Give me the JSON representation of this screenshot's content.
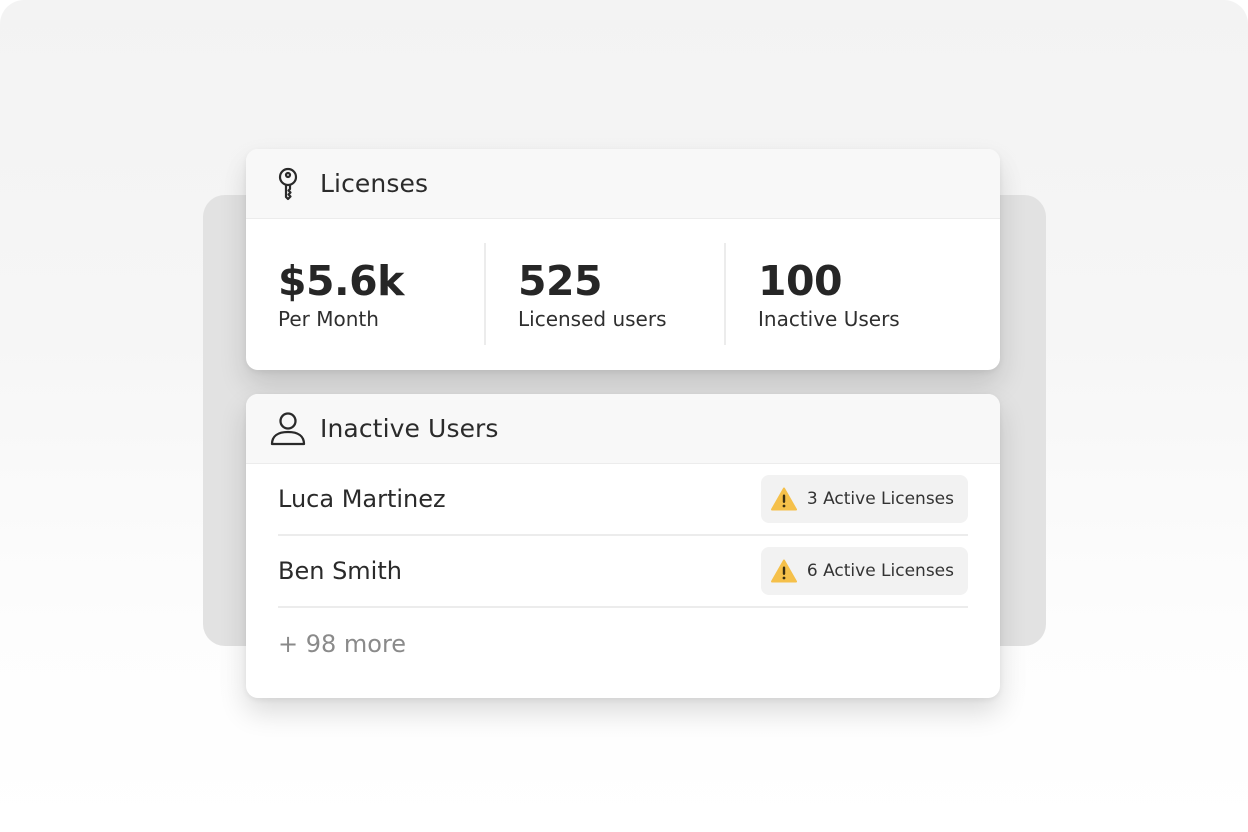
{
  "licenses": {
    "title": "Licenses",
    "icon": "key-icon",
    "stats": [
      {
        "value": "$5.6k",
        "label": "Per Month"
      },
      {
        "value": "525",
        "label": "Licensed users"
      },
      {
        "value": "100",
        "label": "Inactive Users"
      }
    ]
  },
  "inactive_users": {
    "title": "Inactive Users",
    "icon": "user-icon",
    "rows": [
      {
        "name": "Luca Martinez",
        "badge": "3 Active Licenses"
      },
      {
        "name": "Ben Smith",
        "badge": "6 Active Licenses"
      }
    ],
    "more": "+ 98 more"
  },
  "colors": {
    "warning": "#F5C04A",
    "warning_mark": "#3a2f12",
    "muted_text": "#8a8a8a"
  }
}
